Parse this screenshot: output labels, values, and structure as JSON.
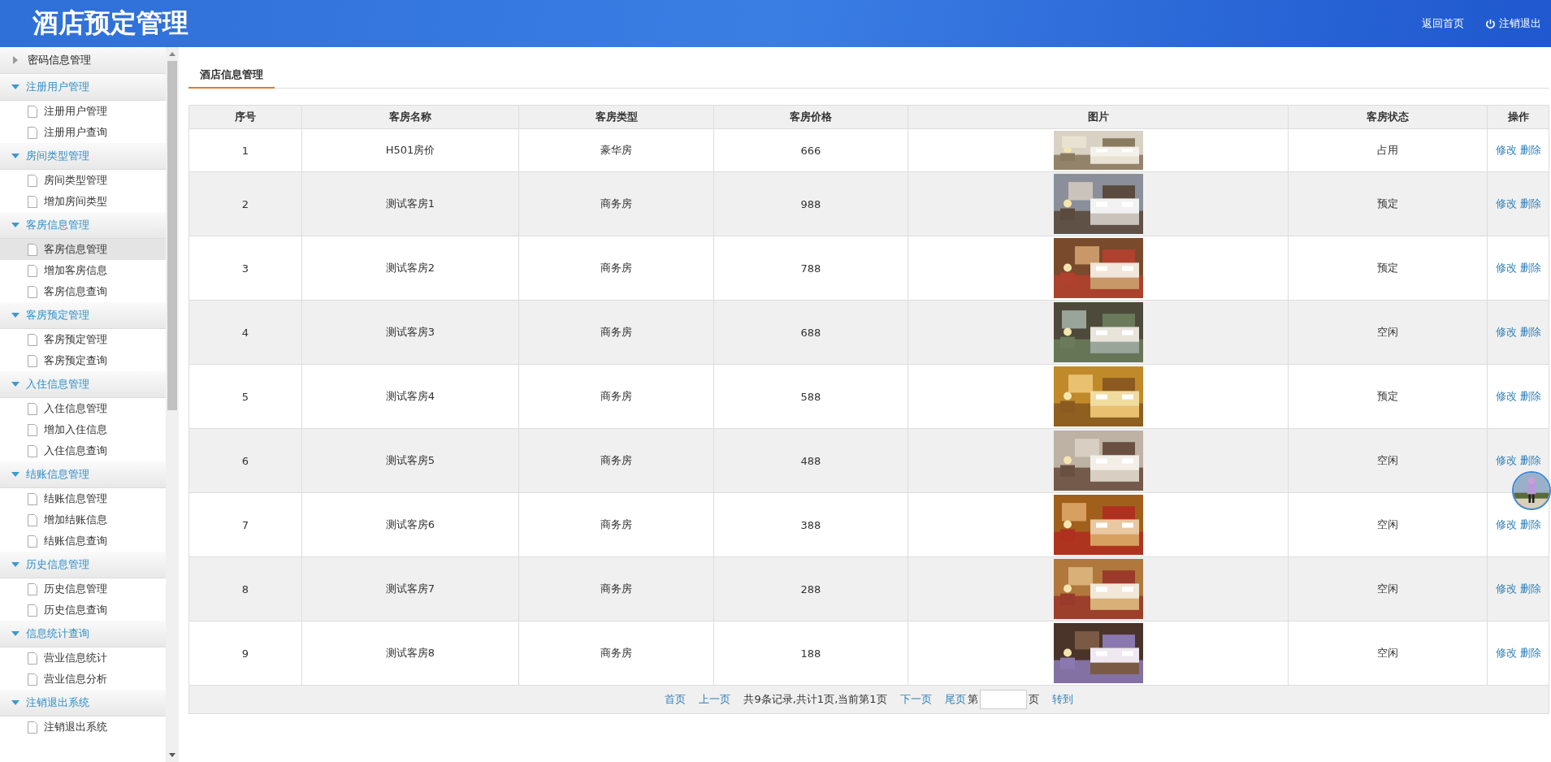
{
  "header": {
    "title": "酒店预定管理",
    "links": [
      {
        "label": "返回首页",
        "kind": "plain"
      },
      {
        "label": "注销退出",
        "kind": "power"
      }
    ]
  },
  "sidebar": {
    "groups": [
      {
        "label": "密码信息管理",
        "expanded": false
      },
      {
        "label": "注册用户管理",
        "expanded": true,
        "items": [
          {
            "label": "注册用户管理",
            "selected": false
          },
          {
            "label": "注册用户查询",
            "selected": false
          }
        ]
      },
      {
        "label": "房间类型管理",
        "expanded": true,
        "items": [
          {
            "label": "房间类型管理",
            "selected": false
          },
          {
            "label": "增加房间类型",
            "selected": false
          }
        ]
      },
      {
        "label": "客房信息管理",
        "expanded": true,
        "items": [
          {
            "label": "客房信息管理",
            "selected": true
          },
          {
            "label": "增加客房信息",
            "selected": false
          },
          {
            "label": "客房信息查询",
            "selected": false
          }
        ]
      },
      {
        "label": "客房预定管理",
        "expanded": true,
        "items": [
          {
            "label": "客房预定管理",
            "selected": false
          },
          {
            "label": "客房预定查询",
            "selected": false
          }
        ]
      },
      {
        "label": "入住信息管理",
        "expanded": true,
        "items": [
          {
            "label": "入住信息管理",
            "selected": false
          },
          {
            "label": "增加入住信息",
            "selected": false
          },
          {
            "label": "入住信息查询",
            "selected": false
          }
        ]
      },
      {
        "label": "结账信息管理",
        "expanded": true,
        "items": [
          {
            "label": "结账信息管理",
            "selected": false
          },
          {
            "label": "增加结账信息",
            "selected": false
          },
          {
            "label": "结账信息查询",
            "selected": false
          }
        ]
      },
      {
        "label": "历史信息管理",
        "expanded": true,
        "items": [
          {
            "label": "历史信息管理",
            "selected": false
          },
          {
            "label": "历史信息查询",
            "selected": false
          }
        ]
      },
      {
        "label": "信息统计查询",
        "expanded": true,
        "items": [
          {
            "label": "营业信息统计",
            "selected": false
          },
          {
            "label": "营业信息分析",
            "selected": false
          }
        ]
      },
      {
        "label": "注销退出系统",
        "expanded": true,
        "items": [
          {
            "label": "注销退出系统",
            "selected": false
          }
        ]
      }
    ]
  },
  "tab": {
    "label": "酒店信息管理"
  },
  "table": {
    "columns": [
      "序号",
      "客房名称",
      "客房类型",
      "客房价格",
      "图片",
      "客房状态",
      "操作"
    ],
    "rows": [
      {
        "no": "1",
        "name": "H501房价",
        "type": "豪华房",
        "price": "666",
        "status": "占用",
        "actions": [
          "修改",
          "删除"
        ]
      },
      {
        "no": "2",
        "name": "测试客房1",
        "type": "商务房",
        "price": "988",
        "status": "预定",
        "actions": [
          "修改",
          "删除"
        ]
      },
      {
        "no": "3",
        "name": "测试客房2",
        "type": "商务房",
        "price": "788",
        "status": "预定",
        "actions": [
          "修改",
          "删除"
        ]
      },
      {
        "no": "4",
        "name": "测试客房3",
        "type": "商务房",
        "price": "688",
        "status": "空闲",
        "actions": [
          "修改",
          "删除"
        ]
      },
      {
        "no": "5",
        "name": "测试客房4",
        "type": "商务房",
        "price": "588",
        "status": "预定",
        "actions": [
          "修改",
          "删除"
        ]
      },
      {
        "no": "6",
        "name": "测试客房5",
        "type": "商务房",
        "price": "488",
        "status": "空闲",
        "actions": [
          "修改",
          "删除"
        ]
      },
      {
        "no": "7",
        "name": "测试客房6",
        "type": "商务房",
        "price": "388",
        "status": "空闲",
        "actions": [
          "修改",
          "删除"
        ]
      },
      {
        "no": "8",
        "name": "测试客房7",
        "type": "商务房",
        "price": "288",
        "status": "空闲",
        "actions": [
          "修改",
          "删除"
        ]
      },
      {
        "no": "9",
        "name": "测试客房8",
        "type": "商务房",
        "price": "188",
        "status": "空闲",
        "actions": [
          "修改",
          "删除"
        ]
      }
    ]
  },
  "pagination": {
    "first": "首页",
    "prev": "上一页",
    "summary": "共9条记录,共计1页,当前第1页",
    "next": "下一页",
    "last": "尾页",
    "page_prefix": "第",
    "page_suffix": "页",
    "go": "转到"
  }
}
